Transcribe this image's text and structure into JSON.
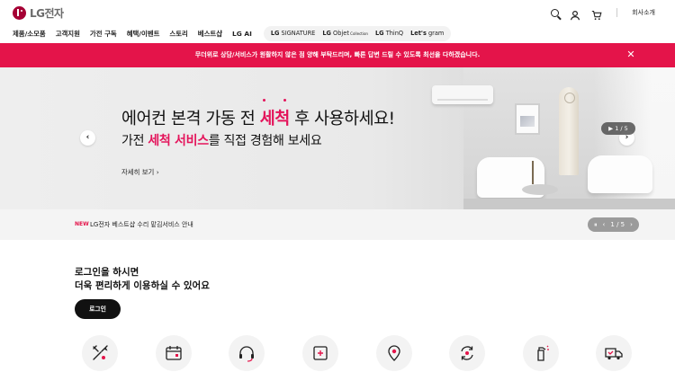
{
  "header": {
    "logo_text": "LG전자",
    "corp_link": "회사소개",
    "icons": [
      "search-icon",
      "user-icon",
      "cart-icon"
    ]
  },
  "gnb": {
    "items": [
      "제품/소모품",
      "고객지원",
      "가전 구독",
      "혜택/이벤트",
      "스토리",
      "베스트샵",
      "LG AI"
    ],
    "brands": [
      {
        "bold": "LG",
        "text": " SIGNATURE",
        "small": ""
      },
      {
        "bold": "LG",
        "text": " Objet",
        "small": " Collection"
      },
      {
        "bold": "LG",
        "text": " ThinQ",
        "small": ""
      },
      {
        "bold": "Let's",
        "text": " gram",
        "small": ""
      }
    ]
  },
  "notice": {
    "text": "무더위로 상담/서비스가 원활하지 않은 점 양해 부탁드리며, 빠른 답변 드릴 수 있도록 최선을 다하겠습니다.",
    "close_icon": "close-icon"
  },
  "hero": {
    "title_pre": "에어컨 본격 가동 전 ",
    "title_highlight": "세척",
    "title_post": " 후 사용하세요!",
    "sub_pre": "가전 ",
    "sub_highlight": "세척 서비스",
    "sub_post": "를 직접 경험해 보세요",
    "link": "자세히 보기 ›",
    "prev": "‹",
    "next": "›",
    "pagination": "▶ 1 / 5",
    "highlight_color": "#e4145b"
  },
  "news": {
    "badge": "NEW",
    "text": "LG전자 베스트샵 수리 맡김서비스 안내",
    "pause": "⏸",
    "prev": "‹",
    "page": "1 / 5",
    "next": "›"
  },
  "login": {
    "title_line1": "로그인을 하시면",
    "title_line2": "더욱 편리하게 이용하실 수 있어요",
    "button": "로그인"
  },
  "quick_menu": {
    "icons": [
      "repair-tools-icon",
      "calendar-icon",
      "headset-icon",
      "manual-icon",
      "location-pin-icon",
      "refresh-service-icon",
      "cleaning-spray-icon",
      "delivery-truck-icon"
    ]
  },
  "colors": {
    "brand": "#a50034",
    "notice_bg": "#e4144a",
    "accent": "#e4145b"
  }
}
